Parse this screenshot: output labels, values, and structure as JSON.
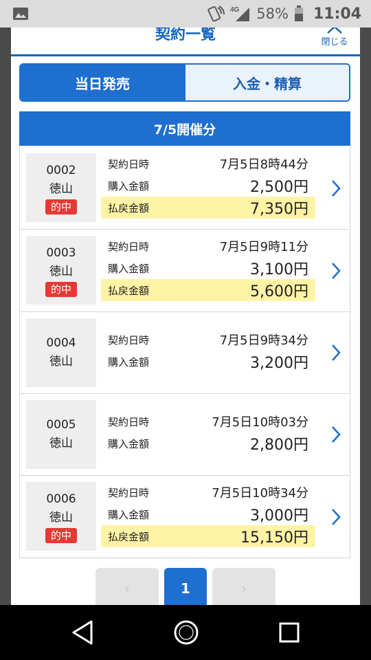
{
  "status_bar": {
    "network": "4G",
    "battery": "58%",
    "time": "11:04"
  },
  "modal": {
    "title": "契約一覧",
    "close_label": "閉じる",
    "tabs": [
      {
        "label": "当日発売",
        "active": true
      },
      {
        "label": "入金・精算",
        "active": false
      }
    ],
    "date_header": "7/5開催分",
    "labels": {
      "contract_datetime": "契約日時",
      "purchase_amount": "購入金額",
      "payout_amount": "払戻金額"
    },
    "contracts": [
      {
        "id": "0002",
        "venue": "徳山",
        "badge": "的中",
        "datetime": "7月5日8時44分",
        "purchase": "2,500円",
        "payout": "7,350円"
      },
      {
        "id": "0003",
        "venue": "徳山",
        "badge": "的中",
        "datetime": "7月5日9時11分",
        "purchase": "3,100円",
        "payout": "5,600円"
      },
      {
        "id": "0004",
        "venue": "徳山",
        "badge": "",
        "datetime": "7月5日9時34分",
        "purchase": "3,200円",
        "payout": ""
      },
      {
        "id": "0005",
        "venue": "徳山",
        "badge": "",
        "datetime": "7月5日10時03分",
        "purchase": "2,800円",
        "payout": ""
      },
      {
        "id": "0006",
        "venue": "徳山",
        "badge": "的中",
        "datetime": "7月5日10時34分",
        "purchase": "3,000円",
        "payout": "15,150円"
      }
    ],
    "pagination": {
      "prev": "‹",
      "current": "1",
      "next": "›"
    }
  },
  "colors": {
    "accent": "#1e6fcf",
    "hit_badge": "#e53935",
    "payout_highlight": "#fff3a6"
  },
  "icons": {
    "status_left": "gallery-icon",
    "close": "chevron-up-icon",
    "row_action": "chevron-right-icon",
    "nav": [
      "back-icon",
      "home-icon",
      "recents-icon"
    ]
  }
}
